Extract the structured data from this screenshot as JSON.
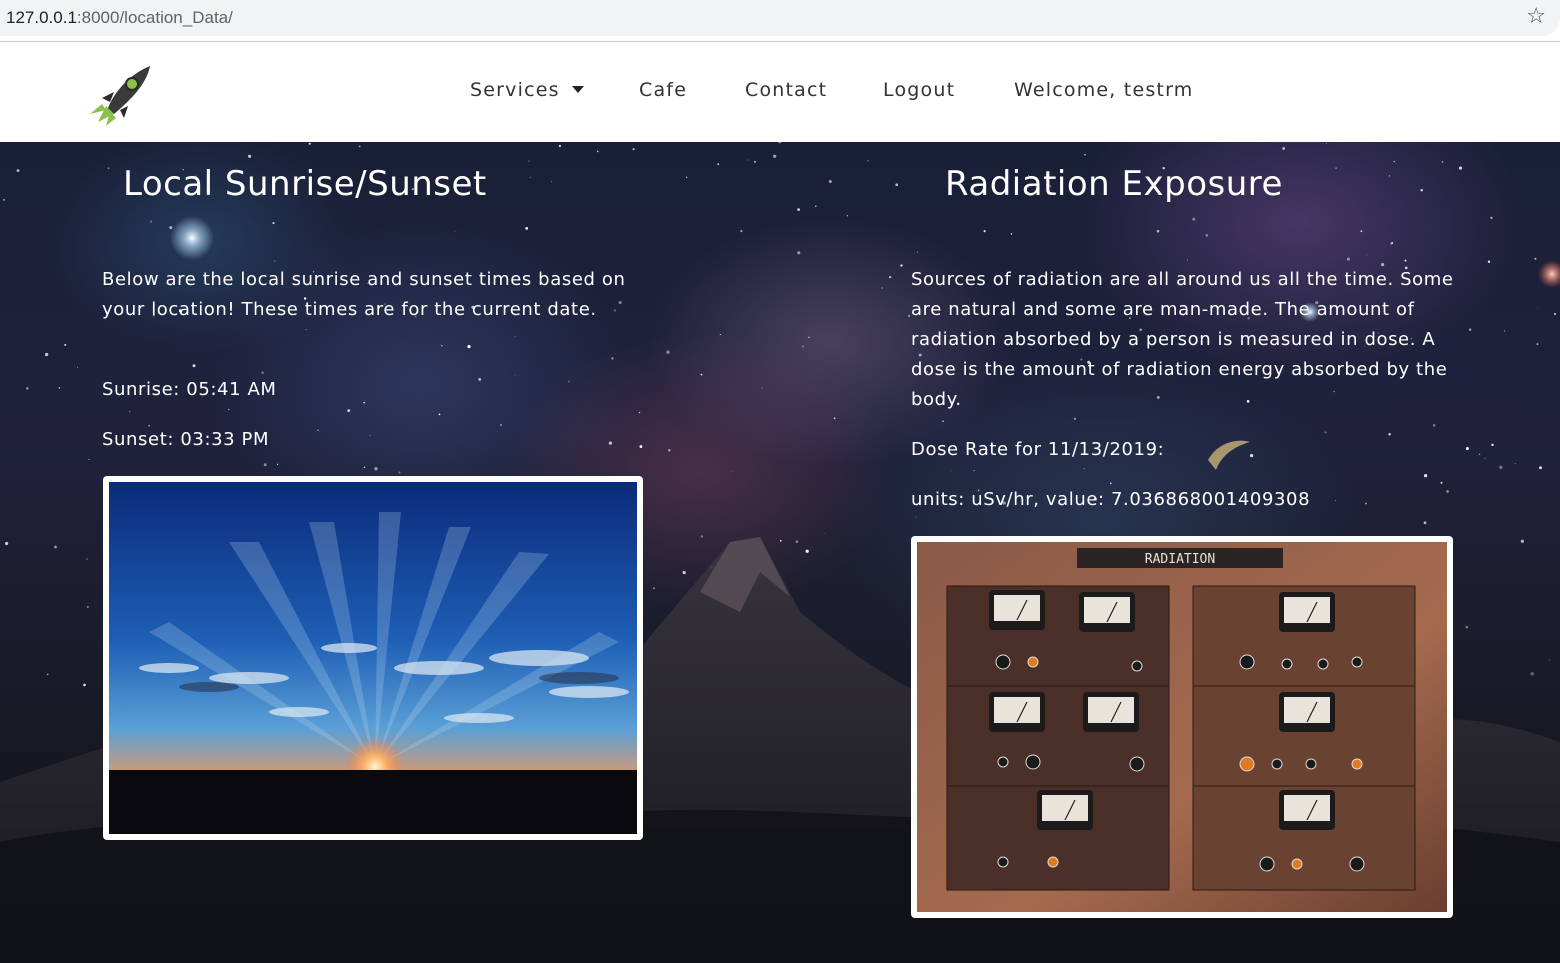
{
  "browser": {
    "url_host": "127.0.0.1",
    "url_path": ":8000/location_Data/",
    "bookmark_icon": "star-icon"
  },
  "navbar": {
    "logo_icon": "rocket-icon",
    "items": [
      {
        "label": "Services",
        "has_dropdown": true
      },
      {
        "label": "Cafe"
      },
      {
        "label": "Contact"
      },
      {
        "label": "Logout"
      },
      {
        "label": "Welcome, testrm"
      }
    ]
  },
  "left": {
    "title": "Local Sunrise/Sunset",
    "description": "Below are the local sunrise and sunset times based on your location! These times are for the current date.",
    "sunrise": "Sunrise: 05:41 AM",
    "sunset": "Sunset: 03:33 PM"
  },
  "right": {
    "title": "Radiation Exposure",
    "description": "Sources of radiation are all around us all the time. Some are natural and some are man-made. The amount of radiation absorbed by a person is measured in dose. A dose is the amount of radiation energy absorbed by the body.",
    "dose_date": "Dose Rate for 11/13/2019:",
    "dose_value": "units: uSv/hr, value: 7.036868001409308",
    "panel_label": "RADIATION"
  },
  "colors": {
    "navbar_bg": "#ffffff",
    "hero_text": "#ffffff",
    "rocket_green": "#8bc34a"
  }
}
